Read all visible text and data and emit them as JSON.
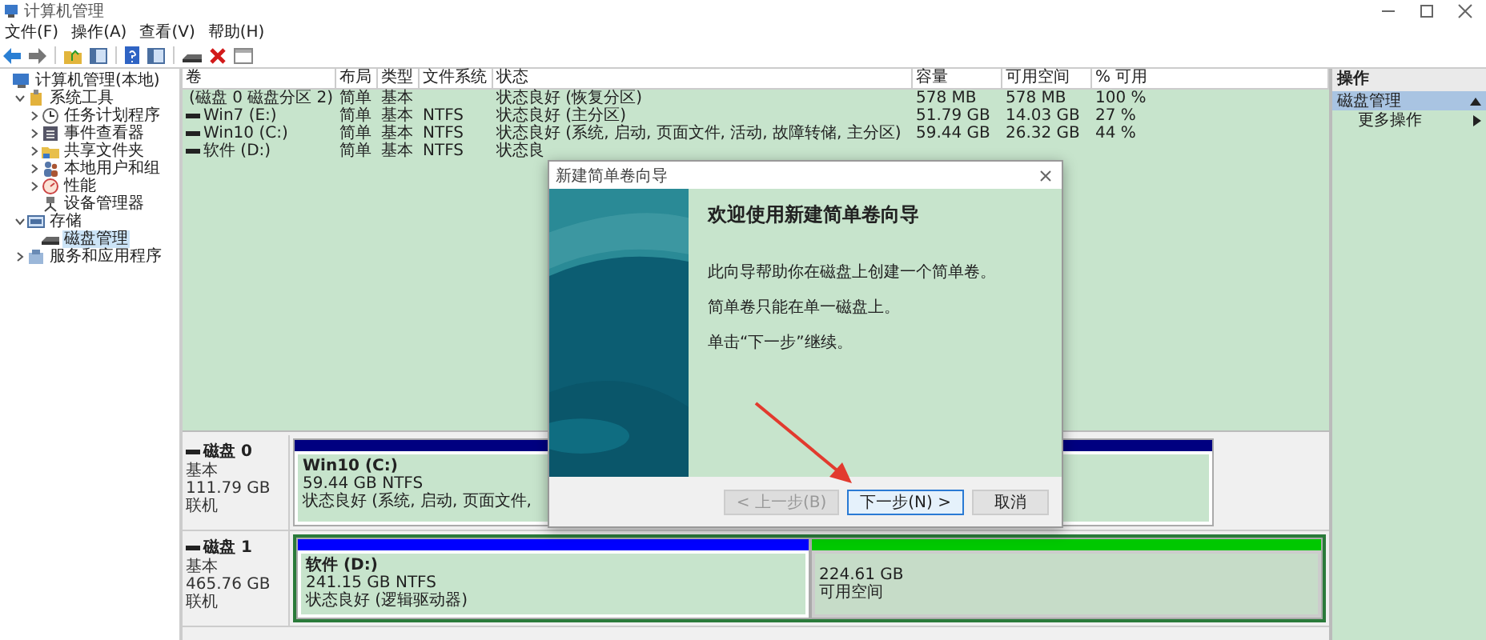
{
  "window": {
    "title": "计算机管理"
  },
  "menu": [
    "文件(F)",
    "操作(A)",
    "查看(V)",
    "帮助(H)"
  ],
  "tree": [
    {
      "label": "计算机管理(本地)",
      "selected": false,
      "children": [
        {
          "label": "系统工具",
          "expanded": true,
          "selected": false,
          "children": [
            {
              "label": "任务计划程序",
              "expanded": false,
              "selected": false
            },
            {
              "label": "事件查看器",
              "expanded": false,
              "selected": false
            },
            {
              "label": "共享文件夹",
              "expanded": false,
              "selected": false
            },
            {
              "label": "本地用户和组",
              "expanded": false,
              "selected": false
            },
            {
              "label": "性能",
              "expanded": false,
              "selected": false
            },
            {
              "label": "设备管理器",
              "selected": false
            }
          ]
        },
        {
          "label": "存储",
          "expanded": true,
          "selected": false,
          "children": [
            {
              "label": "磁盘管理",
              "selected": true
            }
          ]
        },
        {
          "label": "服务和应用程序",
          "expanded": false,
          "selected": false
        }
      ]
    }
  ],
  "table": {
    "columns": [
      "卷",
      "布局",
      "类型",
      "文件系统",
      "状态",
      "容量",
      "可用空间",
      "% 可用"
    ],
    "rows": [
      [
        "(磁盘 0 磁盘分区 2)",
        "简单",
        "基本",
        null,
        "状态良好 (恢复分区)",
        "578 MB",
        "578 MB",
        "100 %"
      ],
      [
        "Win7 (E:)",
        "简单",
        "基本",
        "NTFS",
        "状态良好 (主分区)",
        "51.79 GB",
        "14.03 GB",
        "27 %"
      ],
      [
        "Win10 (C:)",
        "简单",
        "基本",
        "NTFS",
        "状态良好 (系统, 启动, 页面文件, 活动, 故障转储, 主分区)",
        "59.44 GB",
        "26.32 GB",
        "44 %"
      ],
      [
        "软件 (D:)",
        "简单",
        "基本",
        "NTFS",
        "状态良"
      ]
    ]
  },
  "disks": [
    {
      "name": "磁盘 0",
      "type": "基本",
      "size": "111.79 GB",
      "status": "联机",
      "extended": false,
      "partitions": [
        {
          "kind": "primary",
          "name": "Win10 (C:)",
          "size": "59.44 GB NTFS",
          "status": "状态良好 (系统, 启动, 页面文件,"
        }
      ]
    },
    {
      "name": "磁盘 1",
      "type": "基本",
      "size": "465.76 GB",
      "status": "联机",
      "extended": true,
      "partitions": [
        {
          "kind": "logical",
          "name": "软件 (D:)",
          "size": "241.15 GB NTFS",
          "status": "状态良好 (逻辑驱动器)"
        },
        {
          "kind": "free",
          "size": "224.61 GB",
          "status": "可用空间"
        }
      ]
    }
  ],
  "actions": {
    "title": "操作",
    "items": [
      {
        "kind": "section",
        "label": "磁盘管理",
        "selected": true
      },
      {
        "kind": "submenu",
        "label": "更多操作",
        "selected": false
      }
    ]
  },
  "wizard": {
    "title": "新建简单卷向导",
    "heading": "欢迎使用新建简单卷向导",
    "paragraphs": [
      "此向导帮助你在磁盘上创建一个简单卷。",
      "简单卷只能在单一磁盘上。",
      "单击“下一步”继续。"
    ],
    "buttons": [
      {
        "label": "< 上一步(B)",
        "disabled": true,
        "focused": false
      },
      {
        "label": "下一步(N) >",
        "disabled": false,
        "focused": true
      },
      {
        "label": "取消",
        "disabled": false,
        "focused": false
      }
    ]
  }
}
